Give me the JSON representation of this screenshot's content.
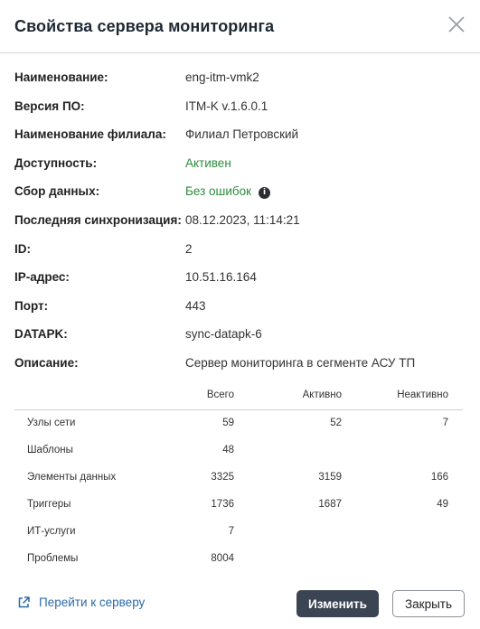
{
  "dialog": {
    "title": "Свойства сервера мониторинга"
  },
  "properties": [
    {
      "label": "Наименование:",
      "value": "eng-itm-vmk2"
    },
    {
      "label": "Версия ПО:",
      "value": "ITM-K v.1.6.0.1"
    },
    {
      "label": "Наименование филиала:",
      "value": "Филиал Петровский"
    },
    {
      "label": "Доступность:",
      "value": "Активен"
    },
    {
      "label": "Сбор данных:",
      "value": "Без ошибок"
    },
    {
      "label": "Последняя синхронизация:",
      "value": "08.12.2023, 11:14:21"
    },
    {
      "label": "ID:",
      "value": "2"
    },
    {
      "label": "IP-адрес:",
      "value": "10.51.16.164"
    },
    {
      "label": "Порт:",
      "value": "443"
    },
    {
      "label": "DATAPK:",
      "value": "sync-datapk-6"
    },
    {
      "label": "Описание:",
      "value": "Сервер мониторинга в сегменте АСУ ТП"
    }
  ],
  "info_icon_glyph": "i",
  "stats": {
    "headers": [
      "",
      "Всего",
      "Активно",
      "Неактивно"
    ],
    "rows": [
      [
        "Узлы сети",
        "59",
        "52",
        "7"
      ],
      [
        "Шаблоны",
        "48",
        "",
        ""
      ],
      [
        "Элементы данных",
        "3325",
        "3159",
        "166"
      ],
      [
        "Триггеры",
        "1736",
        "1687",
        "49"
      ],
      [
        "ИТ-услуги",
        "7",
        "",
        ""
      ],
      [
        "Проблемы",
        "8004",
        "",
        ""
      ]
    ]
  },
  "footer": {
    "link_label": "Перейти к серверу",
    "edit_label": "Изменить",
    "close_label": "Закрыть"
  },
  "colors": {
    "accent_dark": "#3b4452",
    "status_green": "#2e8b3e",
    "link_blue": "#2b6aa8"
  }
}
